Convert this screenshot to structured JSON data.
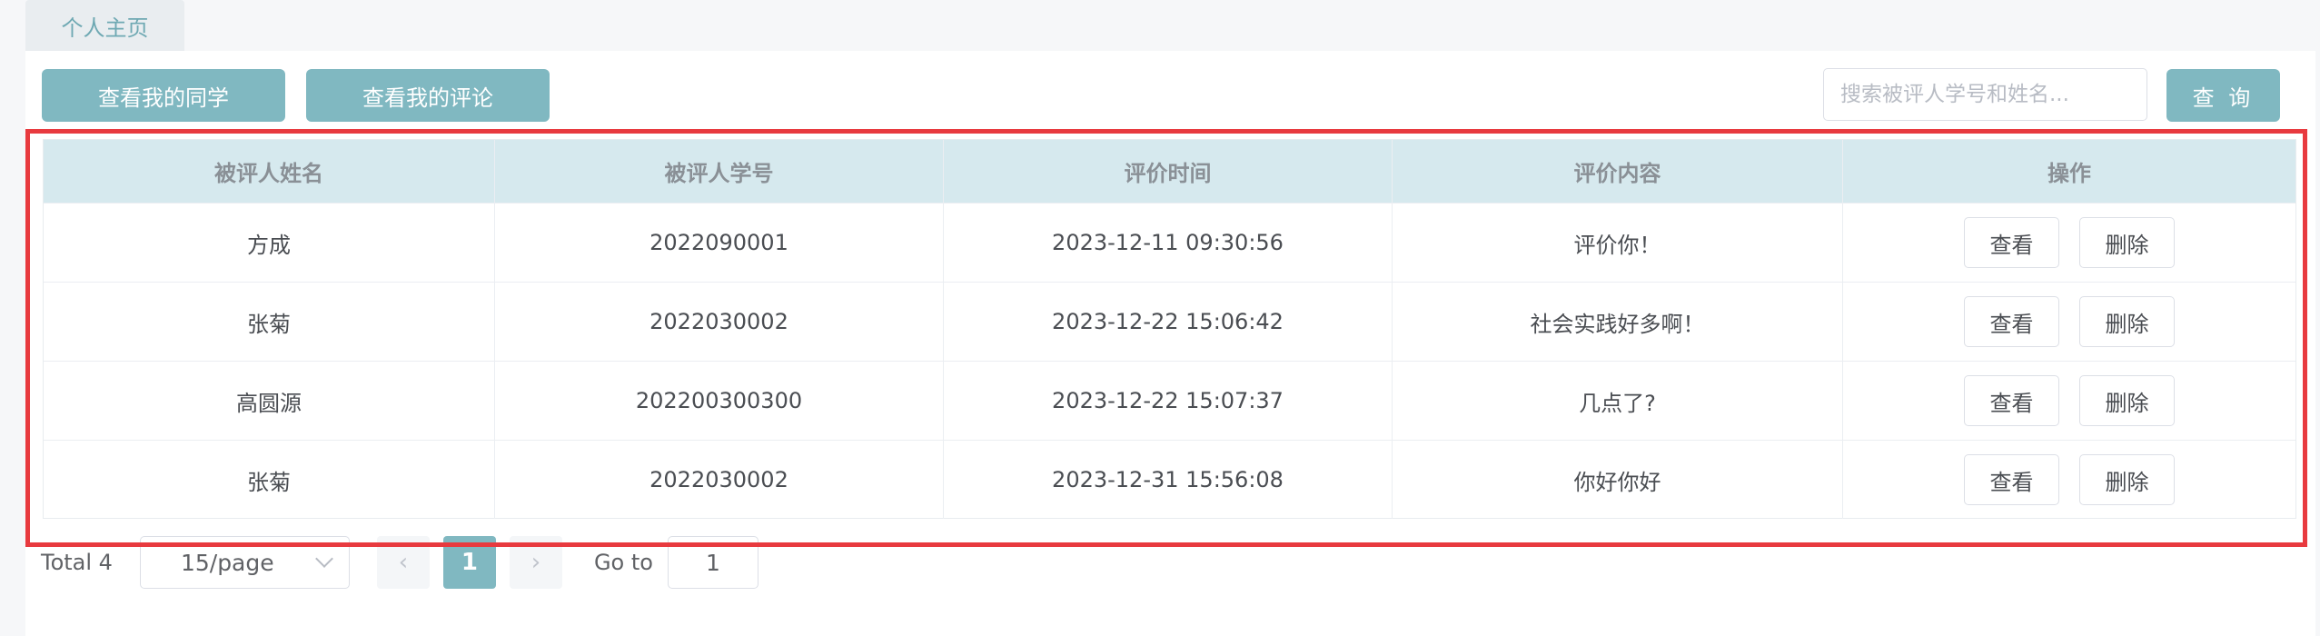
{
  "tabs": [
    {
      "label": "个人主页"
    }
  ],
  "toolbar": {
    "view_classmates_label": "查看我的同学",
    "view_comments_label": "查看我的评论",
    "search_placeholder": "搜索被评人学号和姓名...",
    "search_value": "",
    "query_label": "查 询"
  },
  "table": {
    "headers": [
      "被评人姓名",
      "被评人学号",
      "评价时间",
      "评价内容",
      "操作"
    ],
    "rows": [
      {
        "name": "方成",
        "student_id": "2022090001",
        "time": "2023-12-11 09:30:56",
        "content": "评价你！"
      },
      {
        "name": "张菊",
        "student_id": "2022030002",
        "time": "2023-12-22 15:06:42",
        "content": "社会实践好多啊！"
      },
      {
        "name": "高圆源",
        "student_id": "202200300300",
        "time": "2023-12-22 15:07:37",
        "content": "几点了?"
      },
      {
        "name": "张菊",
        "student_id": "2022030002",
        "time": "2023-12-31 15:56:08",
        "content": "你好你好"
      }
    ],
    "actions": {
      "view_label": "查看",
      "delete_label": "删除"
    }
  },
  "pagination": {
    "total_label": "Total 4",
    "page_size": "15/page",
    "prev_icon": "‹",
    "current_page": "1",
    "next_icon": "›",
    "goto_label": "Go to",
    "goto_value": "1"
  },
  "colors": {
    "accent": "#80b8c1",
    "header_bg": "#d6e9ee",
    "highlight_border": "#e83a3f"
  }
}
